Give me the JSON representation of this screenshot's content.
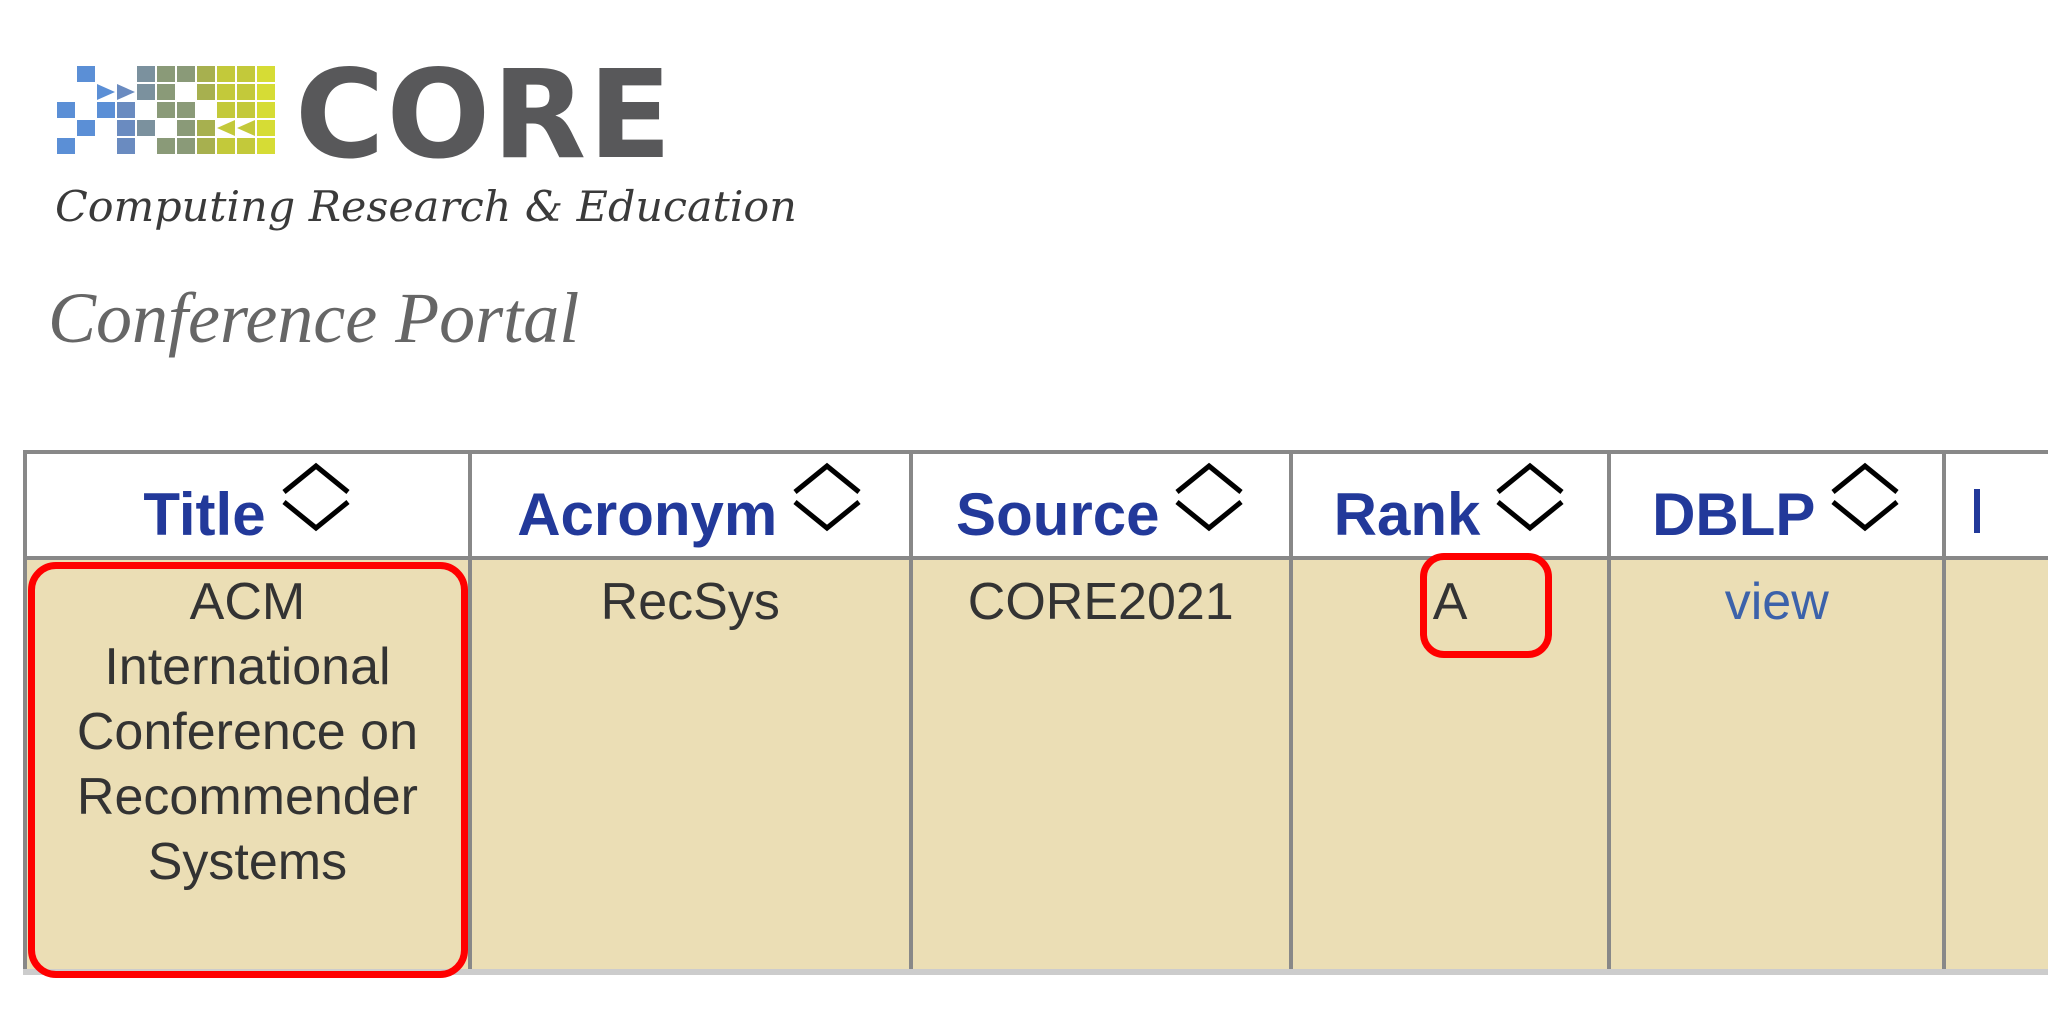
{
  "logo": {
    "wordmark": "CORE",
    "tagline": "Computing Research & Education",
    "grid_colors": [
      "#5b8fd6",
      "#6a8bc0",
      "#7b919e",
      "#8a9a78",
      "#a7b04f",
      "#c3c93a",
      "#d6dc35"
    ]
  },
  "page": {
    "title": "Conference Portal"
  },
  "table": {
    "columns": [
      {
        "label": "Title",
        "sort_icon": "sort-icon"
      },
      {
        "label": "Acronym",
        "sort_icon": "sort-icon"
      },
      {
        "label": "Source",
        "sort_icon": "sort-icon"
      },
      {
        "label": "Rank",
        "sort_icon": "sort-icon"
      },
      {
        "label": "DBLP",
        "sort_icon": "sort-icon"
      },
      {
        "label": "",
        "sort_icon": ""
      }
    ],
    "rows": [
      {
        "title": "ACM International Conference on Recommender Systems",
        "acronym": "RecSys",
        "source": "CORE2021",
        "rank": "A",
        "dblp": "view",
        "extra": ""
      }
    ]
  },
  "colors": {
    "header_text": "#22399a",
    "row_background": "#ebdeb5",
    "link": "#3c62aa",
    "highlight": "#ff0000"
  }
}
